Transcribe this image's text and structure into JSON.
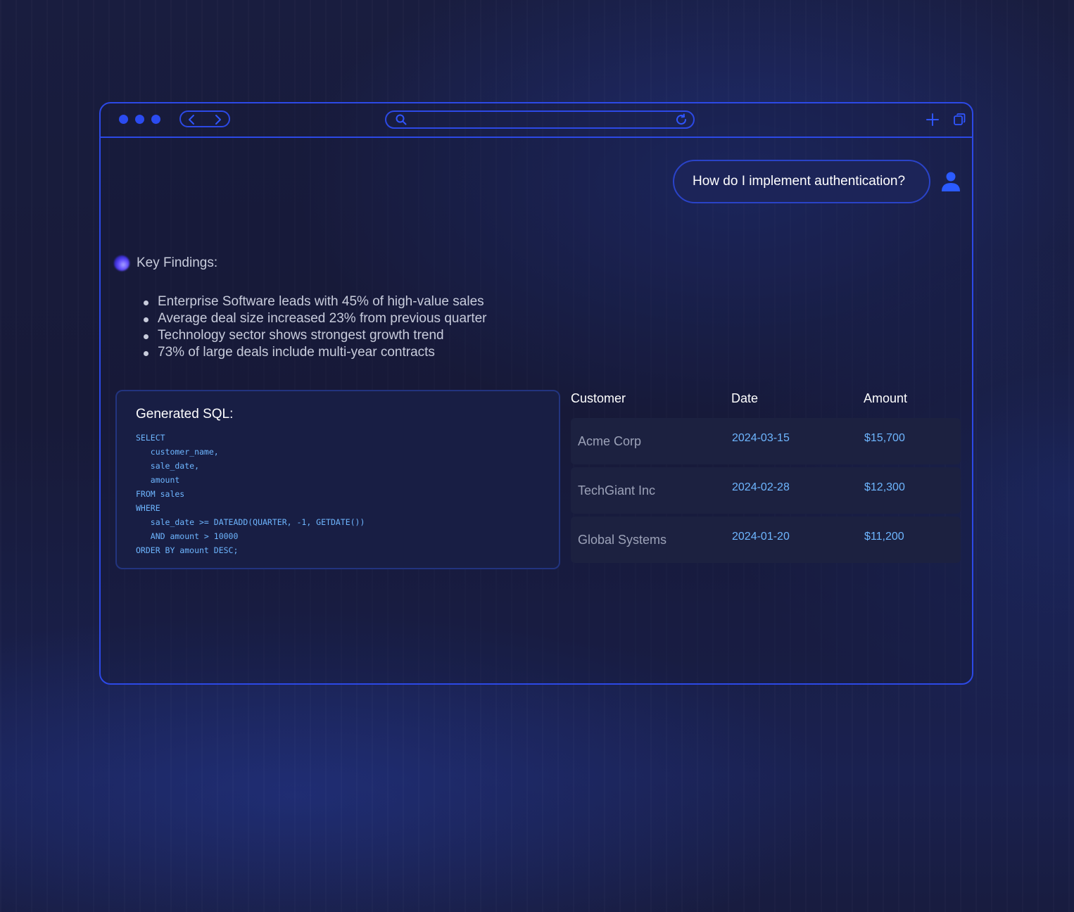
{
  "colors": {
    "accent": "#2c49e6",
    "code": "#6eb6ff",
    "text_muted": "#c8ccdc"
  },
  "browser": {
    "traffic_lights": [
      "dot",
      "dot",
      "dot"
    ],
    "url_value": "",
    "icons": {
      "back": "chevron-left-icon",
      "forward": "chevron-right-icon",
      "search": "search-icon",
      "reload": "reload-icon",
      "new_tab": "plus-icon",
      "tabs": "copy-icon"
    }
  },
  "chat": {
    "user_message": "How do I implement authentication?",
    "user_avatar_icon": "user-icon",
    "assistant_icon": "ai-orb-icon",
    "findings_title": "Key Findings:",
    "findings": [
      "Enterprise Software leads with 45% of high-value sales",
      "Average deal size increased 23% from previous quarter",
      "Technology sector shows strongest growth trend",
      "73% of large deals include multi-year contracts"
    ]
  },
  "sql": {
    "title": "Generated SQL:",
    "code": "SELECT\n   customer_name,\n   sale_date,\n   amount\nFROM sales\nWHERE\n   sale_date >= DATEADD(QUARTER, -1, GETDATE())\n   AND amount > 10000\nORDER BY amount DESC;"
  },
  "results": {
    "headers": [
      "Customer",
      "Date",
      "Amount"
    ],
    "rows": [
      {
        "customer": "Acme Corp",
        "date": "2024-03-15",
        "amount": "$15,700"
      },
      {
        "customer": "TechGiant Inc",
        "date": "2024-02-28",
        "amount": "$12,300"
      },
      {
        "customer": "Global Systems",
        "date": "2024-01-20",
        "amount": "$11,200"
      }
    ]
  }
}
